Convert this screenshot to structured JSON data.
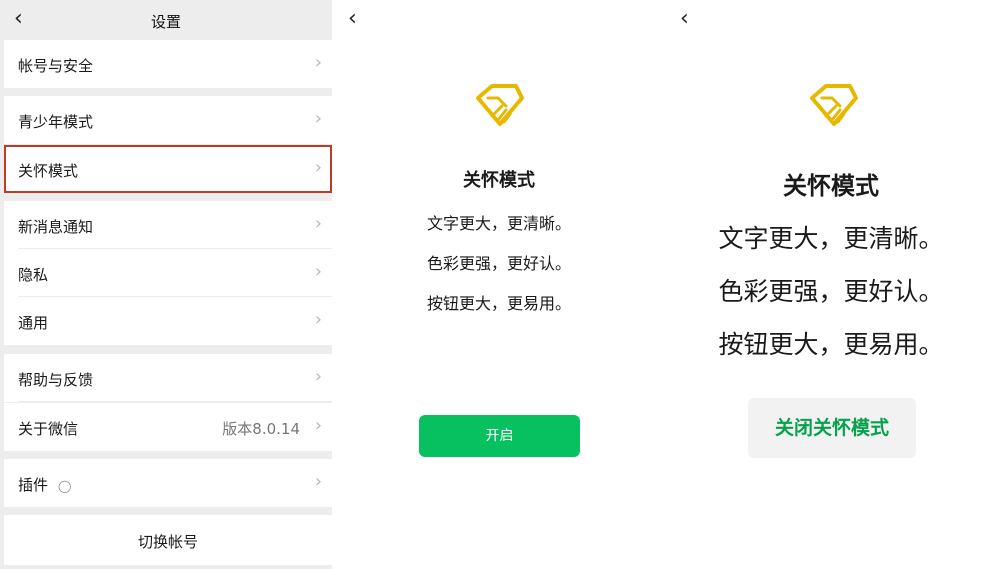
{
  "settings": {
    "title": "设置",
    "rows": [
      {
        "label": "帐号与安全"
      },
      {
        "label": "青少年模式"
      },
      {
        "label": "关怀模式"
      },
      {
        "label": "新消息通知"
      },
      {
        "label": "隐私"
      },
      {
        "label": "通用"
      },
      {
        "label": "帮助与反馈"
      },
      {
        "label": "关于微信",
        "value": "版本8.0.14"
      },
      {
        "label": "插件"
      }
    ],
    "switch_account": "切换帐号"
  },
  "care_intro": {
    "title": "关怀模式",
    "lines": [
      "文字更大，更清晰。",
      "色彩更强，更好认。",
      "按钮更大，更易用。"
    ],
    "enable_button": "开启"
  },
  "care_on": {
    "title": "关怀模式",
    "lines": [
      "文字更大，更清晰。",
      "色彩更强，更好认。",
      "按钮更大，更易用。"
    ],
    "disable_button": "关闭关怀模式"
  },
  "colors": {
    "accent_green": "#07c160",
    "highlight_red": "#c0392b",
    "icon_gold": "#e6b800"
  }
}
